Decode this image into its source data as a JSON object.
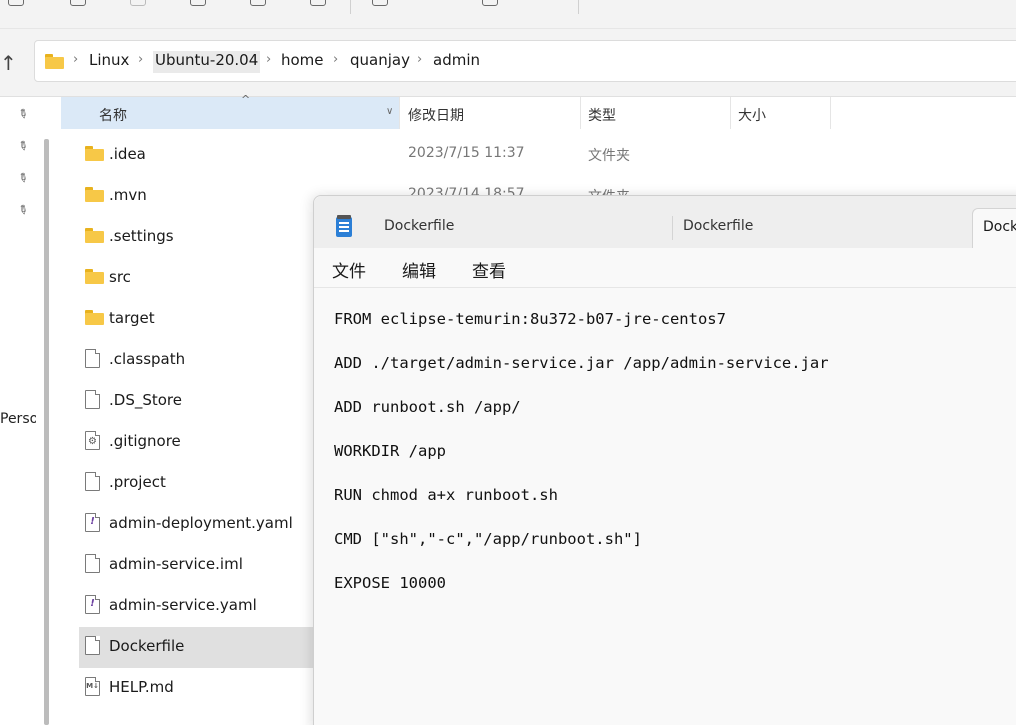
{
  "explorer": {
    "breadcrumbs": [
      "Linux",
      "Ubuntu-20.04",
      "home",
      "quanjay",
      "admin"
    ],
    "nav_person_label": "Perso",
    "columns": {
      "name": "名称",
      "date": "修改日期",
      "type": "类型",
      "size": "大小"
    },
    "files": [
      {
        "name": ".idea",
        "date": "2023/7/15 11:37",
        "type": "文件夹",
        "icon": "folder-icon"
      },
      {
        "name": ".mvn",
        "date": "2023/7/14 18:57",
        "type": "文件夹",
        "icon": "folder-icon"
      },
      {
        "name": ".settings",
        "date": "",
        "type": "",
        "icon": "folder-icon"
      },
      {
        "name": "src",
        "date": "",
        "type": "",
        "icon": "folder-icon"
      },
      {
        "name": "target",
        "date": "",
        "type": "",
        "icon": "folder-icon"
      },
      {
        "name": ".classpath",
        "date": "",
        "type": "",
        "icon": "file-icon"
      },
      {
        "name": ".DS_Store",
        "date": "",
        "type": "",
        "icon": "file-icon"
      },
      {
        "name": ".gitignore",
        "date": "",
        "type": "",
        "icon": "settings-file-icon"
      },
      {
        "name": ".project",
        "date": "",
        "type": "",
        "icon": "file-icon"
      },
      {
        "name": "admin-deployment.yaml",
        "date": "",
        "type": "",
        "icon": "yaml-file-icon"
      },
      {
        "name": "admin-service.iml",
        "date": "",
        "type": "",
        "icon": "file-icon"
      },
      {
        "name": "admin-service.yaml",
        "date": "",
        "type": "",
        "icon": "yaml-file-icon"
      },
      {
        "name": "Dockerfile",
        "date": "",
        "type": "",
        "icon": "file-icon",
        "selected": true
      },
      {
        "name": "HELP.md",
        "date": "",
        "type": "",
        "icon": "markdown-file-icon"
      }
    ]
  },
  "notepad": {
    "tabs": [
      "Dockerfile",
      "Dockerfile",
      "Dock"
    ],
    "menu": [
      "文件",
      "编辑",
      "查看"
    ],
    "lines": [
      "FROM eclipse-temurin:8u372-b07-jre-centos7",
      "ADD ./target/admin-service.jar /app/admin-service.jar",
      "ADD runboot.sh /app/",
      "WORKDIR /app",
      "RUN chmod a+x runboot.sh",
      "CMD [\"sh\",\"-c\",\"/app/runboot.sh\"]",
      "EXPOSE 10000"
    ]
  },
  "colors": {
    "accent_header": "#dbe9f7",
    "folder": "#f7c847",
    "selection": "#e0e0e0",
    "notepad_icon": "#2b7fd6"
  }
}
